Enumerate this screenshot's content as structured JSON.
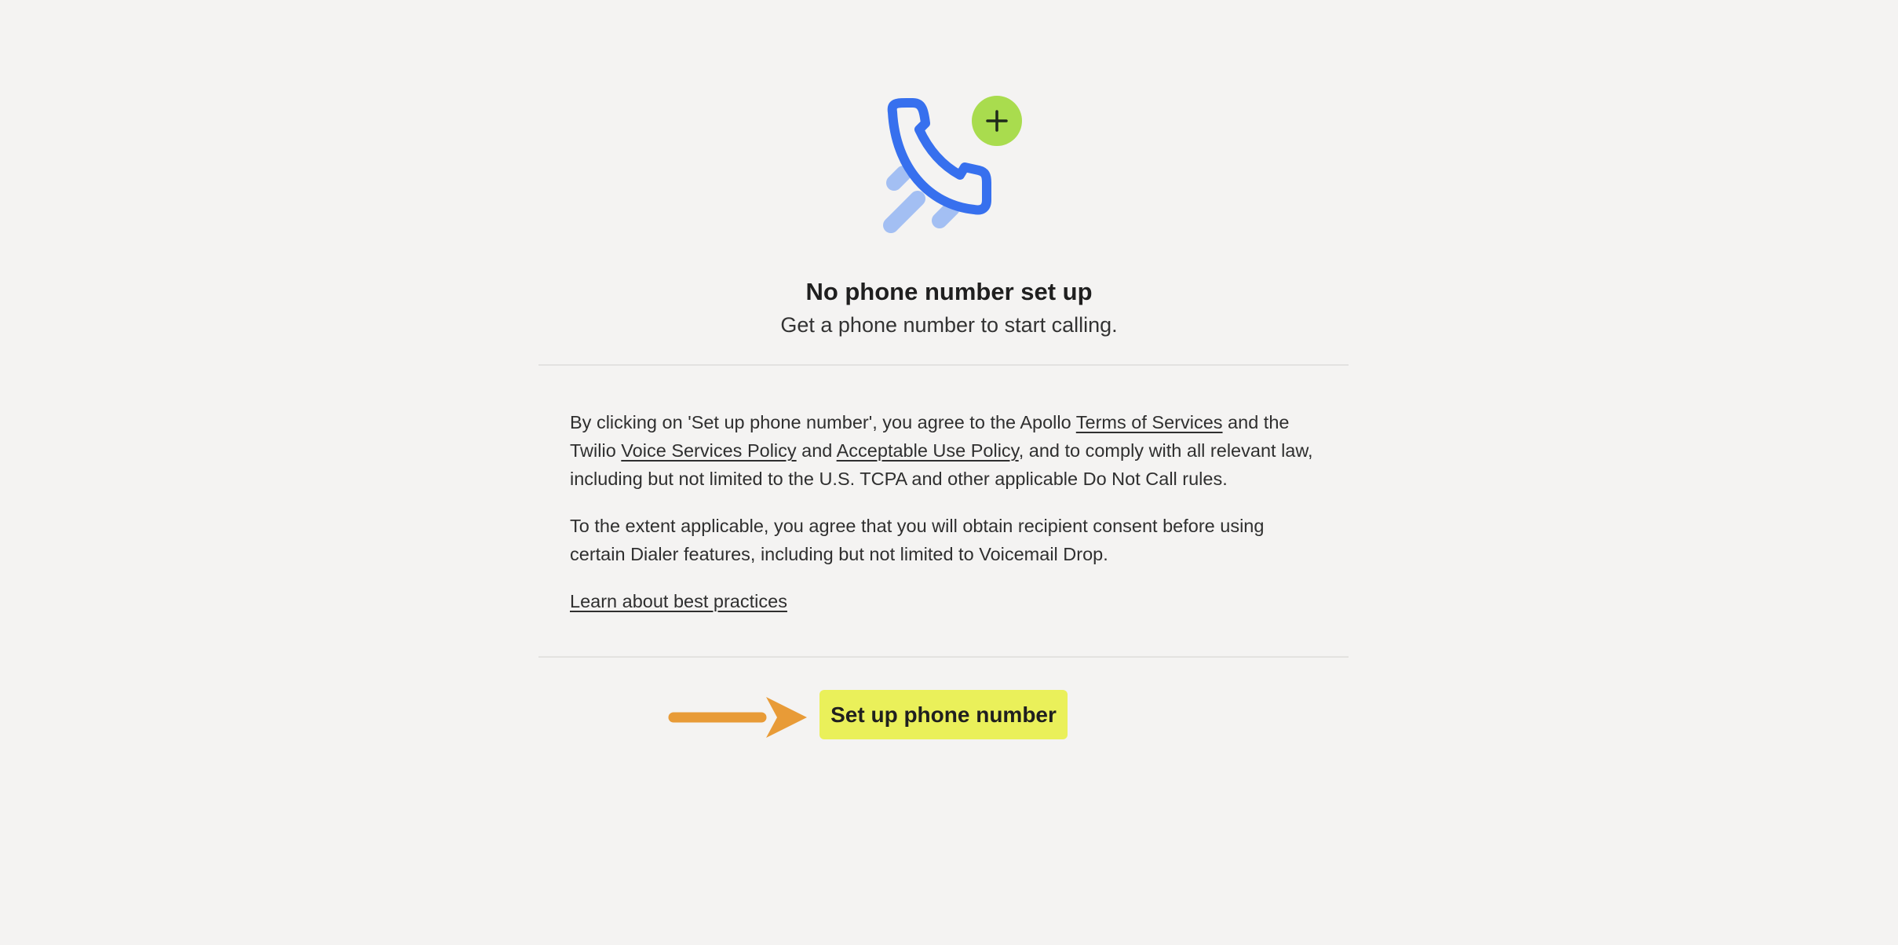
{
  "empty_state": {
    "title": "No phone number set up",
    "subtitle": "Get a phone number to start calling."
  },
  "legal": {
    "p1_part1": "By clicking on 'Set up phone number', you agree to the Apollo ",
    "terms_link": "Terms of Services",
    "p1_part2": " and the Twilio ",
    "voice_policy_link": "Voice Services Policy",
    "p1_part3": " and ",
    "aup_link": "Acceptable Use Policy",
    "p1_part4": ", and to comply with all relevant law, including but not limited to the U.S. TCPA and other applicable Do Not Call rules.",
    "p2": "To the extent applicable, you agree that you will obtain recipient consent before using certain Dialer features, including but not limited to Voicemail Drop.",
    "best_practices_link": "Learn about best practices"
  },
  "cta": {
    "label": "Set up phone number"
  },
  "icons": {
    "illustration": "phone-add-icon",
    "pointer": "arrow-right-icon"
  },
  "colors": {
    "background": "#f4f3f2",
    "phone_blue": "#3770ee",
    "phone_blue_light": "#a3bff3",
    "plus_green": "#a9dc4e",
    "cta_yellow": "#eaf05a",
    "arrow_orange": "#e89b37"
  }
}
